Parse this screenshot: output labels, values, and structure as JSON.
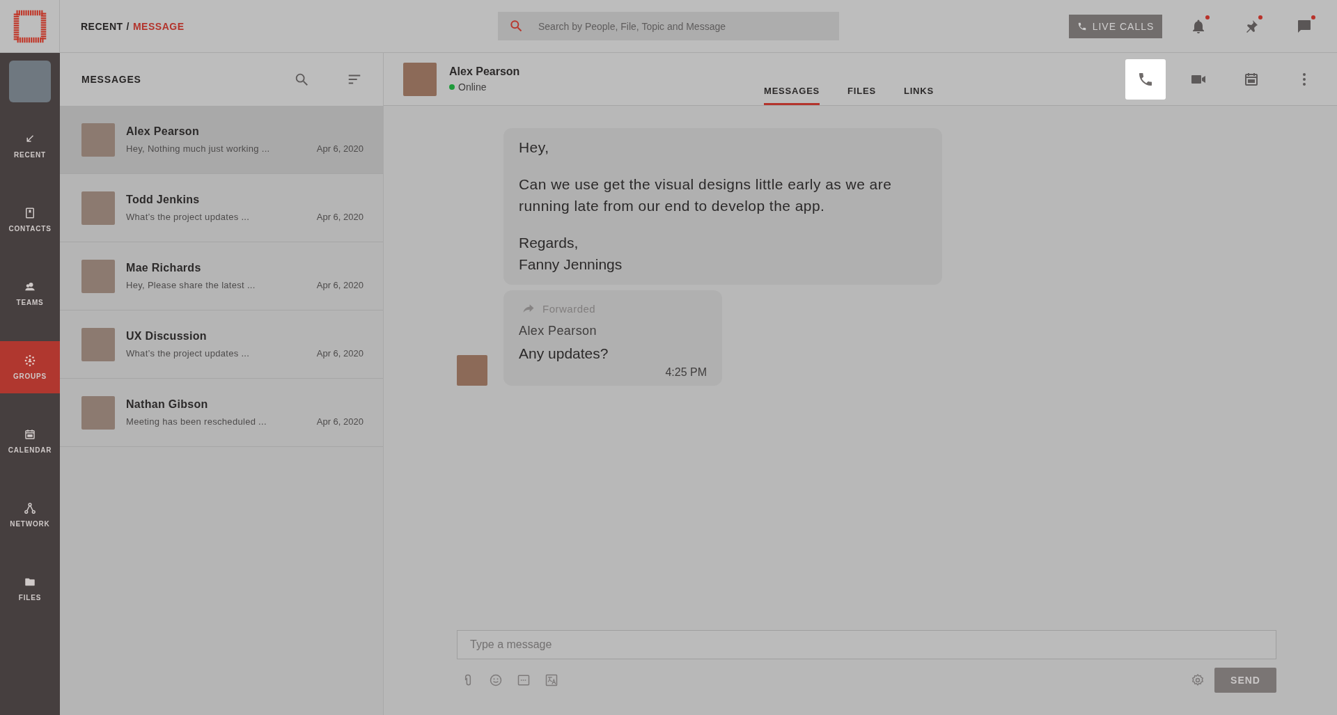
{
  "topbar": {
    "breadcrumb": {
      "parent": "RECENT",
      "separator": "/",
      "current": "MESSAGE"
    },
    "search": {
      "placeholder": "Search by People, File, Topic and Message"
    },
    "live_calls": "LIVE CALLS",
    "alerts": [
      {
        "kind": "bell",
        "unread": true
      },
      {
        "kind": "pin",
        "unread": true
      },
      {
        "kind": "chat",
        "unread": true
      }
    ]
  },
  "sidebar": {
    "items": [
      {
        "kind": "recent",
        "label": "RECENT",
        "selected": false
      },
      {
        "kind": "contacts",
        "label": "CONTACTS",
        "selected": false
      },
      {
        "kind": "teams",
        "label": "TEAMS",
        "selected": false
      },
      {
        "kind": "groups",
        "label": "GROUPS",
        "selected": true
      },
      {
        "kind": "calendar",
        "label": "CALENDAR",
        "selected": false
      },
      {
        "kind": "network",
        "label": "NETWORK",
        "selected": false
      },
      {
        "kind": "files",
        "label": "FILES",
        "selected": false
      }
    ]
  },
  "messages_list": {
    "title": "MESSAGES",
    "conversations": [
      {
        "name": "Alex Pearson",
        "preview": "Hey, Nothing much just working ...",
        "date": "Apr 6, 2020",
        "selected": true
      },
      {
        "name": "Todd Jenkins",
        "preview": "What’s the project updates ...",
        "date": "Apr 6, 2020",
        "selected": false
      },
      {
        "name": "Mae Richards",
        "preview": "Hey, Please share the latest ...",
        "date": "Apr 6, 2020",
        "selected": false
      },
      {
        "name": "UX Discussion",
        "preview": "What’s the project updates ...",
        "date": "Apr 6, 2020",
        "selected": false
      },
      {
        "name": "Nathan Gibson",
        "preview": "Meeting has been rescheduled ...",
        "date": "Apr 6, 2020",
        "selected": false
      }
    ]
  },
  "chat": {
    "contact": {
      "name": "Alex Pearson",
      "status": "Online",
      "online": true
    },
    "tabs": [
      {
        "label": "MESSAGES",
        "selected": true
      },
      {
        "label": "FILES",
        "selected": false
      },
      {
        "label": "LINKS",
        "selected": false
      }
    ],
    "actions": [
      {
        "kind": "phone",
        "highlighted": true
      },
      {
        "kind": "video",
        "highlighted": false
      },
      {
        "kind": "calendar",
        "highlighted": false
      },
      {
        "kind": "more",
        "highlighted": false
      }
    ],
    "messages": [
      {
        "kind": "text",
        "paragraphs": [
          "Hey,",
          "Can we use get the visual designs little early as we are running late from our end to develop the app."
        ],
        "signoff": [
          "Regards,",
          "Fanny Jennings"
        ]
      },
      {
        "kind": "forwarded",
        "forward_label": "Forwarded",
        "sender": "Alex Pearson",
        "text": "Any updates?",
        "time": "4:25 PM"
      }
    ],
    "composer": {
      "placeholder": "Type a message",
      "send": "SEND"
    }
  }
}
